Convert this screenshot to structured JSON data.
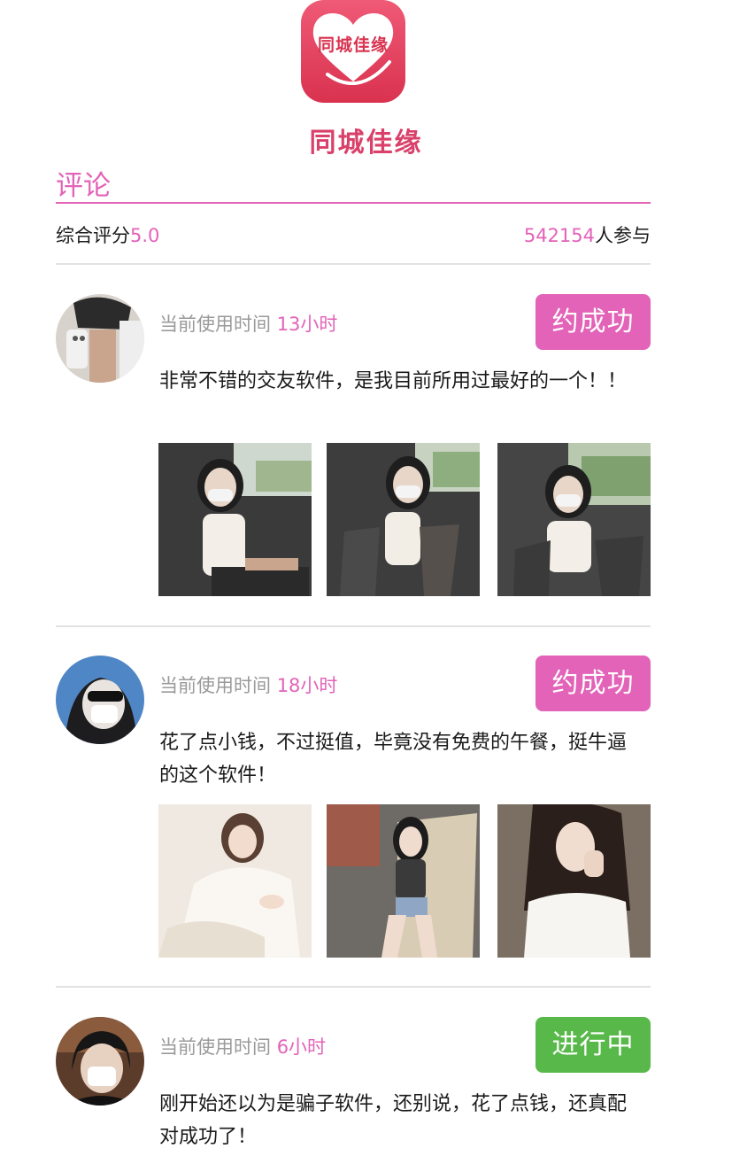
{
  "app": {
    "logo_text": "同城佳缘",
    "name": "同城佳缘",
    "brand_color": "#d9406a"
  },
  "section": {
    "title": "评论",
    "accent_color": "#e263b8"
  },
  "summary": {
    "rating_label": "综合评分",
    "rating_value": "5.0",
    "participants_value": "542154",
    "participants_label": "人参与"
  },
  "reviews": [
    {
      "usage_label": "当前使用时间",
      "usage_value": "13小时",
      "status": "约成功",
      "status_color": "#e263b8",
      "comment": "非常不错的交友软件，是我目前所用过最好的一个！！",
      "photos": [
        "car-selfie-photo",
        "car-selfie-photo",
        "car-selfie-photo"
      ]
    },
    {
      "usage_label": "当前使用时间",
      "usage_value": "18小时",
      "status": "约成功",
      "status_color": "#e263b8",
      "comment": "花了点小钱，不过挺值，毕竟没有免费的午餐，挺牛逼的这个软件！",
      "photos": [
        "portrait-photo",
        "portrait-photo",
        "portrait-photo"
      ]
    },
    {
      "usage_label": "当前使用时间",
      "usage_value": "6小时",
      "status": "进行中",
      "status_color": "#58b94a",
      "comment": "刚开始还以为是骗子软件，还别说，花了点钱，还真配对成功了！"
    }
  ]
}
